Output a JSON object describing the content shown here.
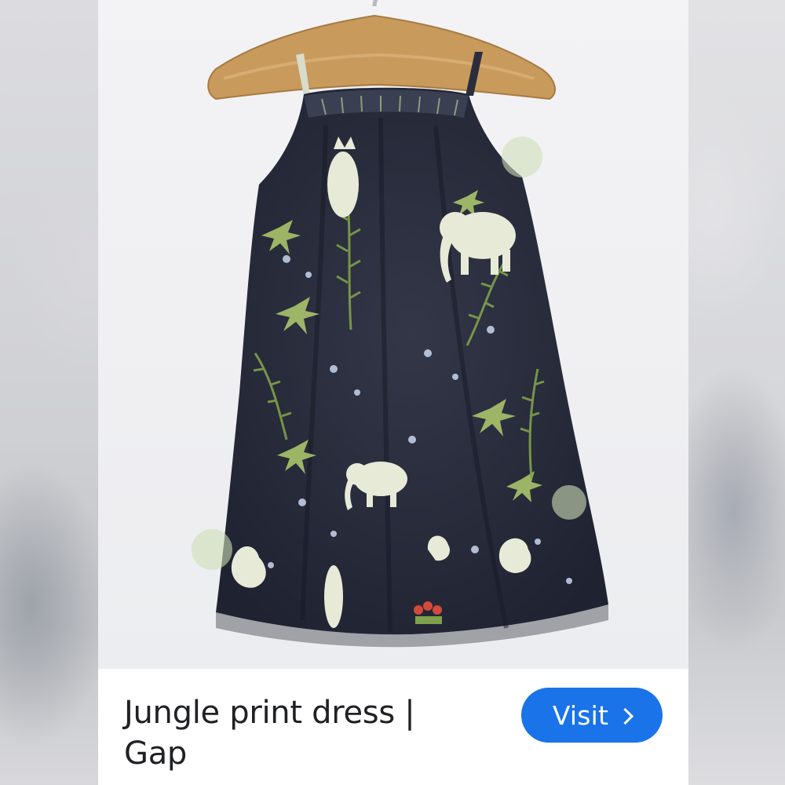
{
  "result": {
    "title": "Jungle print dress | Gap",
    "visit_label": "Visit",
    "visit_icon": "chevron-right-icon"
  },
  "colors": {
    "button_background": "#1a73e8",
    "button_text": "#ffffff",
    "title_text": "#202124",
    "dress_fabric": "#2a2d3c",
    "hanger_wood": "#c89a5c"
  }
}
